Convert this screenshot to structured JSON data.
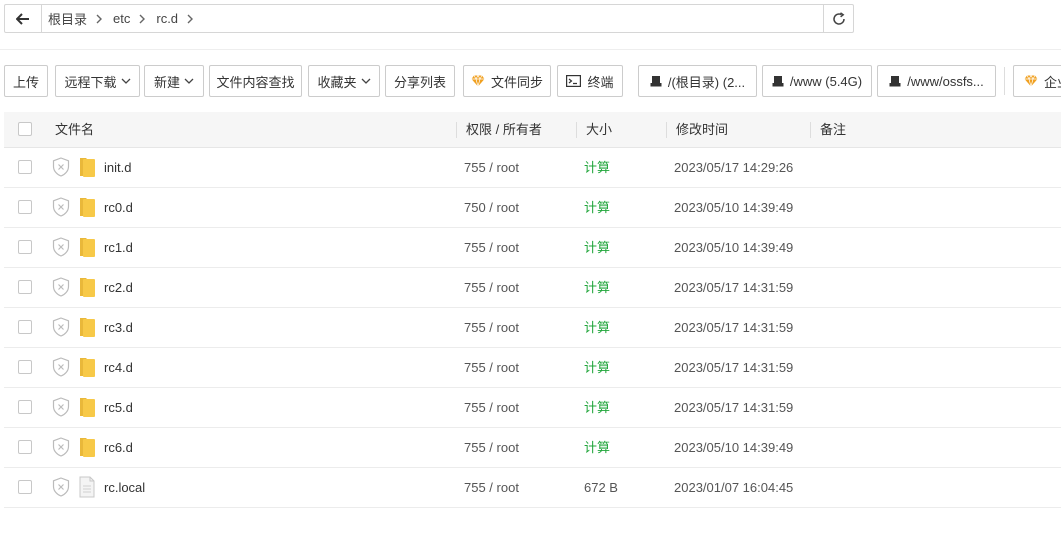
{
  "breadcrumb": {
    "items": [
      "根目录",
      "etc",
      "rc.d"
    ]
  },
  "toolbar": {
    "upload": "上传",
    "remote_download": "远程下载",
    "new": "新建",
    "content_search": "文件内容查找",
    "favorites": "收藏夹",
    "share_list": "分享列表",
    "file_sync": "文件同步",
    "terminal": "终端",
    "disks": [
      "/(根目录) (2...",
      "/www (5.4G)",
      "/www/ossfs..."
    ],
    "enterprise": "企业"
  },
  "table": {
    "headers": {
      "name": "文件名",
      "perm": "权限 / 所有者",
      "size": "大小",
      "mtime": "修改时间",
      "note": "备注"
    },
    "rows": [
      {
        "name": "init.d",
        "type": "folder",
        "perm": "755 / root",
        "size": "计算",
        "mtime": "2023/05/17 14:29:26"
      },
      {
        "name": "rc0.d",
        "type": "folder",
        "perm": "750 / root",
        "size": "计算",
        "mtime": "2023/05/10 14:39:49"
      },
      {
        "name": "rc1.d",
        "type": "folder",
        "perm": "755 / root",
        "size": "计算",
        "mtime": "2023/05/10 14:39:49"
      },
      {
        "name": "rc2.d",
        "type": "folder",
        "perm": "755 / root",
        "size": "计算",
        "mtime": "2023/05/17 14:31:59"
      },
      {
        "name": "rc3.d",
        "type": "folder",
        "perm": "755 / root",
        "size": "计算",
        "mtime": "2023/05/17 14:31:59"
      },
      {
        "name": "rc4.d",
        "type": "folder",
        "perm": "755 / root",
        "size": "计算",
        "mtime": "2023/05/17 14:31:59"
      },
      {
        "name": "rc5.d",
        "type": "folder",
        "perm": "755 / root",
        "size": "计算",
        "mtime": "2023/05/17 14:31:59"
      },
      {
        "name": "rc6.d",
        "type": "folder",
        "perm": "755 / root",
        "size": "计算",
        "mtime": "2023/05/10 14:39:49"
      },
      {
        "name": "rc.local",
        "type": "file",
        "perm": "755 / root",
        "size": "672 B",
        "mtime": "2023/01/07 16:04:45"
      }
    ]
  },
  "colors": {
    "accent_green": "#20a53a",
    "folder_yellow": "#f7c948",
    "diamond_orange": "#f0a020"
  }
}
